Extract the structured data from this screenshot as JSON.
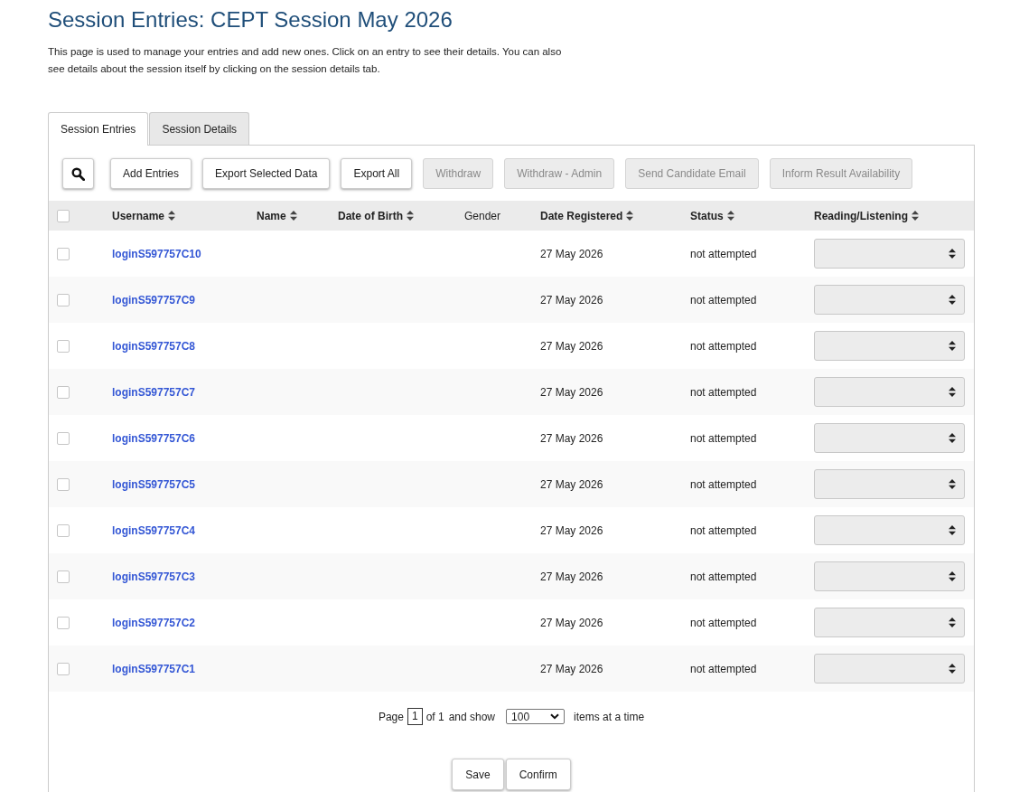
{
  "title": "Session Entries: CEPT Session May 2026",
  "description": "This page is used to manage your entries and add new ones. Click on an entry to see their details. You can also see details about the session itself by clicking on the session details tab.",
  "tabs": [
    {
      "label": "Session Entries",
      "selected": true
    },
    {
      "label": "Session Details",
      "selected": false
    }
  ],
  "toolbar": {
    "buttons": [
      {
        "label": "Add Entries",
        "disabled": false
      },
      {
        "label": "Export Selected Data",
        "disabled": false
      },
      {
        "label": "Export All",
        "disabled": false
      },
      {
        "label": "Withdraw",
        "disabled": true
      },
      {
        "label": "Withdraw - Admin",
        "disabled": true
      },
      {
        "label": "Send Candidate Email",
        "disabled": true
      },
      {
        "label": "Inform Result Availability",
        "disabled": true
      }
    ]
  },
  "table": {
    "select_all": {
      "checked": false
    },
    "columns": [
      {
        "label": "Username",
        "sortable": true
      },
      {
        "label": "Name",
        "sortable": true
      },
      {
        "label": "Date of Birth",
        "sortable": true
      },
      {
        "label": "Gender",
        "sortable": false
      },
      {
        "label": "Date Registered",
        "sortable": true
      },
      {
        "label": "Status",
        "sortable": true
      },
      {
        "label": "Reading/Listening",
        "sortable": true
      }
    ],
    "rows": [
      {
        "checked": false,
        "username": "loginS597757C10",
        "date_registered": "27 May 2026",
        "status": "not attempted"
      },
      {
        "checked": false,
        "username": "loginS597757C9",
        "date_registered": "27 May 2026",
        "status": "not attempted"
      },
      {
        "checked": false,
        "username": "loginS597757C8",
        "date_registered": "27 May 2026",
        "status": "not attempted"
      },
      {
        "checked": false,
        "username": "loginS597757C7",
        "date_registered": "27 May 2026",
        "status": "not attempted"
      },
      {
        "checked": false,
        "username": "loginS597757C6",
        "date_registered": "27 May 2026",
        "status": "not attempted"
      },
      {
        "checked": false,
        "username": "loginS597757C5",
        "date_registered": "27 May 2026",
        "status": "not attempted"
      },
      {
        "checked": false,
        "username": "loginS597757C4",
        "date_registered": "27 May 2026",
        "status": "not attempted"
      },
      {
        "checked": false,
        "username": "loginS597757C3",
        "date_registered": "27 May 2026",
        "status": "not attempted"
      },
      {
        "checked": false,
        "username": "loginS597757C2",
        "date_registered": "27 May 2026",
        "status": "not attempted"
      },
      {
        "checked": false,
        "username": "loginS597757C1",
        "date_registered": "27 May 2026",
        "status": "not attempted"
      }
    ]
  },
  "pagination": {
    "page_label": "Page",
    "page": "1",
    "of_label": "of 1",
    "show_label": "and show",
    "page_size": "100",
    "items_label": "items at a time"
  },
  "footer_buttons": [
    "Save",
    "Confirm"
  ]
}
